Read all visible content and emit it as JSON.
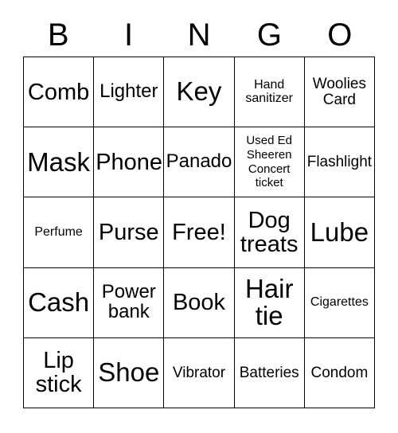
{
  "card": {
    "title": "BINGO",
    "header_letters": [
      "B",
      "I",
      "N",
      "G",
      "O"
    ],
    "free_space_label": "Free!",
    "rows": [
      [
        {
          "text": "Comb",
          "size": "fs-lg"
        },
        {
          "text": "Lighter",
          "size": "fs-md"
        },
        {
          "text": "Key",
          "size": "fs-xl"
        },
        {
          "text": "Hand\nsanitizer",
          "size": "fs-xs"
        },
        {
          "text": "Woolies\nCard",
          "size": "fs-sm"
        }
      ],
      [
        {
          "text": "Mask",
          "size": "fs-xl"
        },
        {
          "text": "Phone",
          "size": "fs-lg"
        },
        {
          "text": "Panado",
          "size": "fs-md"
        },
        {
          "text": "Used Ed\nSheeren\nConcert\nticket",
          "size": "fs-xxs"
        },
        {
          "text": "Flashlight",
          "size": "fs-sm"
        }
      ],
      [
        {
          "text": "Perfume",
          "size": "fs-xs"
        },
        {
          "text": "Purse",
          "size": "fs-lg"
        },
        {
          "text": "Free!",
          "size": "fs-lg"
        },
        {
          "text": "Dog\ntreats",
          "size": "fs-lg"
        },
        {
          "text": "Lube",
          "size": "fs-xl"
        }
      ],
      [
        {
          "text": "Cash",
          "size": "fs-xl"
        },
        {
          "text": "Power\nbank",
          "size": "fs-md"
        },
        {
          "text": "Book",
          "size": "fs-lg"
        },
        {
          "text": "Hair\ntie",
          "size": "fs-xl"
        },
        {
          "text": "Cigarettes",
          "size": "fs-xs"
        }
      ],
      [
        {
          "text": "Lip\nstick",
          "size": "fs-lg"
        },
        {
          "text": "Shoe",
          "size": "fs-xl"
        },
        {
          "text": "Vibrator",
          "size": "fs-sm"
        },
        {
          "text": "Batteries",
          "size": "fs-sm"
        },
        {
          "text": "Condom",
          "size": "fs-sm"
        }
      ]
    ]
  },
  "colors": {
    "background": "#ffffff",
    "text": "#000000",
    "border": "#000000"
  }
}
